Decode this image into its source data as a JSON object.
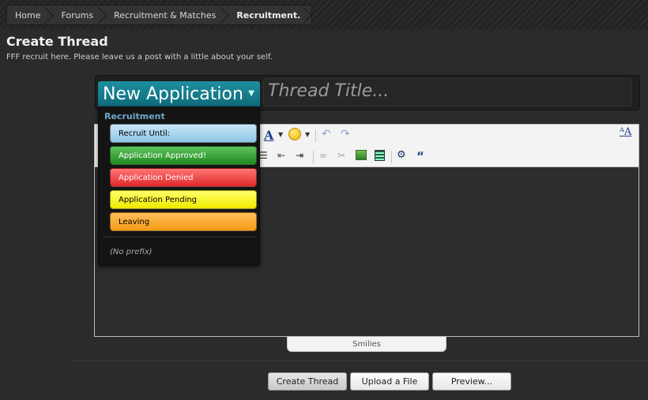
{
  "breadcrumb": {
    "items": [
      "Home",
      "Forums",
      "Recruitment & Matches"
    ],
    "current": "Recruitment."
  },
  "page": {
    "title": "Create Thread",
    "description": "FFF recruit here. Please leave us a post with a little about your self."
  },
  "form": {
    "title_placeholder": "Thread Title..."
  },
  "prefix": {
    "selected": "New Application",
    "group_label": "Recruitment",
    "options": [
      {
        "label": "Recruit Until:",
        "color": "#a8d4f0"
      },
      {
        "label": "Application Approved!",
        "color": "#2f9e2f"
      },
      {
        "label": "Application Denied",
        "color": "#f04a4a"
      },
      {
        "label": "Application Pending",
        "color": "#f8f520"
      },
      {
        "label": "Leaving",
        "color": "#f7ad38"
      }
    ],
    "no_prefix_label": "(No prefix)"
  },
  "editor": {
    "smilies_label": "Smilies"
  },
  "buttons": {
    "create": "Create Thread",
    "upload": "Upload a File",
    "preview": "Preview..."
  }
}
